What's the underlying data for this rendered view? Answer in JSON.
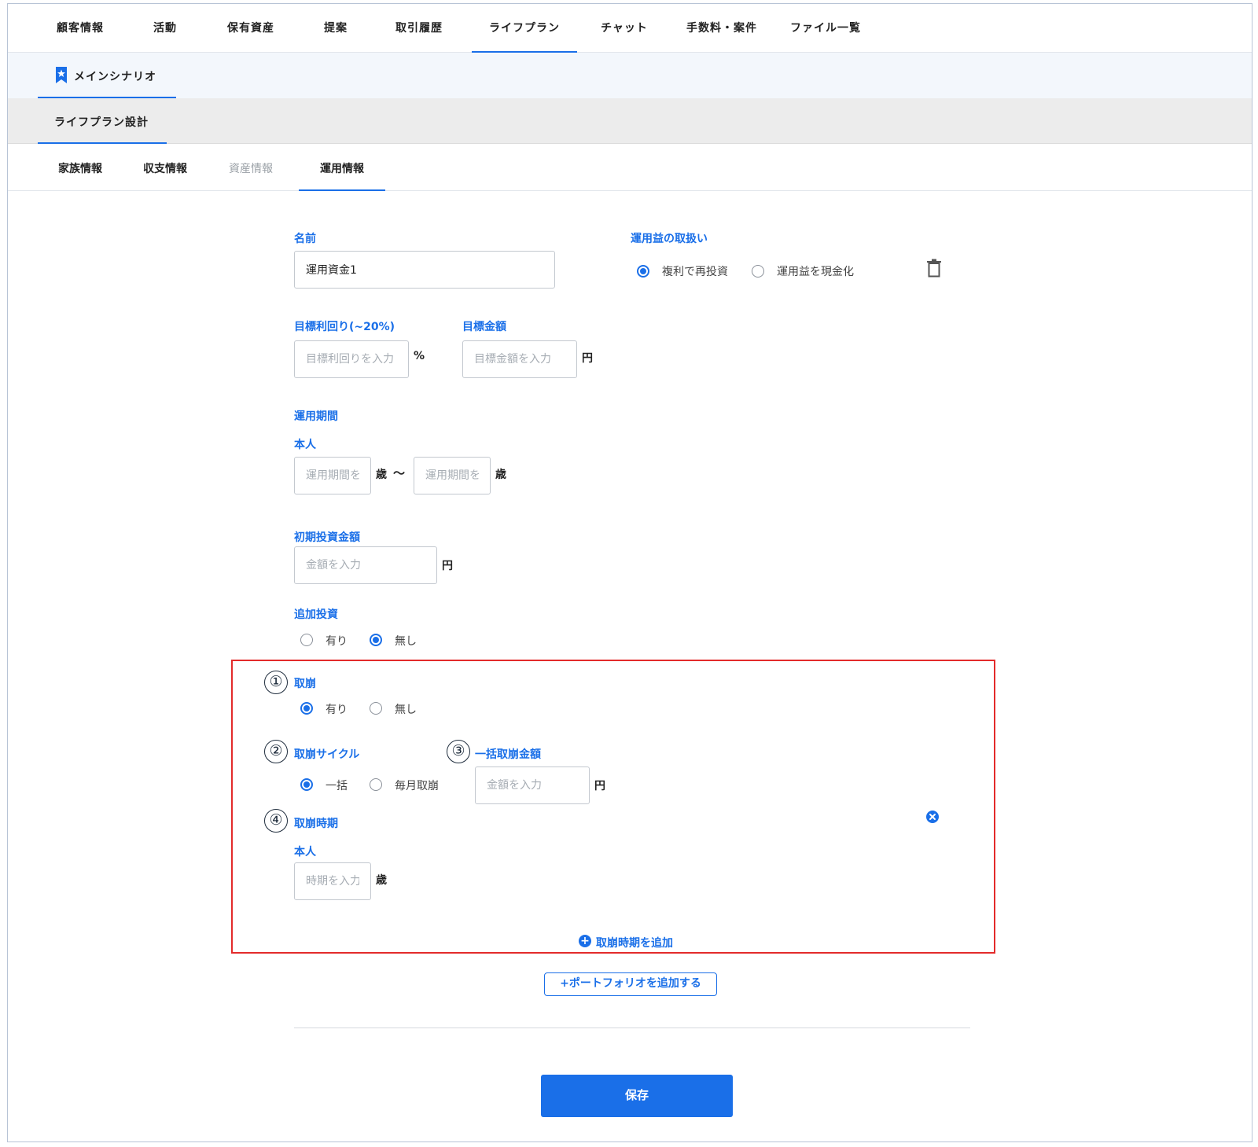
{
  "top_tabs": [
    "顧客情報",
    "活動",
    "保有資産",
    "提案",
    "取引履歴",
    "ライフプラン",
    "チャット",
    "手数料・案件",
    "ファイル一覧"
  ],
  "scenario": {
    "label": "メインシナリオ"
  },
  "design": {
    "label": "ライフプラン設計"
  },
  "sub_tabs": [
    "家族情報",
    "収支情報",
    "資産情報",
    "運用情報"
  ],
  "form": {
    "name_label": "名前",
    "name_value": "運用資金1",
    "profit_label": "運用益の取扱い",
    "profit_opt1": "複利で再投資",
    "profit_opt2": "運用益を現金化",
    "yield_label": "目標利回り(~20%)",
    "yield_placeholder": "目標利回りを入力",
    "yield_unit": "%",
    "target_label": "目標金額",
    "target_placeholder": "目標金額を入力",
    "target_unit": "円",
    "period_label": "運用期間",
    "period_person": "本人",
    "period_from_placeholder": "運用期間を入力",
    "period_to_placeholder": "運用期間を入力",
    "age_unit": "歳",
    "tilde": "〜",
    "initial_label": "初期投資金額",
    "initial_placeholder": "金額を入力",
    "initial_unit": "円",
    "additional_label": "追加投資",
    "additional_yes": "有り",
    "additional_no": "無し",
    "withdraw_label": "取崩",
    "withdraw_yes": "有り",
    "withdraw_no": "無し",
    "cycle_label": "取崩サイクル",
    "cycle_lump": "一括",
    "cycle_monthly": "毎月取崩",
    "lump_amount_label": "一括取崩金額",
    "lump_amount_placeholder": "金額を入力",
    "lump_amount_unit": "円",
    "timing_label": "取崩時期",
    "timing_person": "本人",
    "timing_placeholder": "時期を入力",
    "timing_unit": "歳",
    "add_timing": "取崩時期を追加"
  },
  "annotations": [
    "①",
    "②",
    "③",
    "④"
  ],
  "add_portfolio": "+ポートフォリオを追加する",
  "save": "保存",
  "selected": {
    "profit": "複利で再投資",
    "additional": "無し",
    "withdraw": "有り",
    "cycle": "一括"
  },
  "colors": {
    "accent": "#1a6fe8",
    "highlight": "#e32b2b"
  },
  "icons": {
    "bookmark": "bookmark-star-icon",
    "delete": "trash-icon",
    "remove": "close-circle-icon",
    "add": "plus-circle-icon"
  }
}
